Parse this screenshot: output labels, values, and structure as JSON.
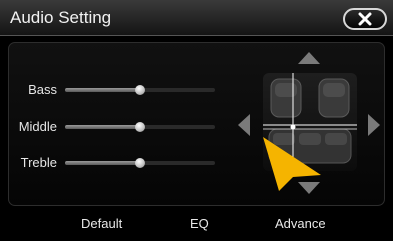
{
  "header": {
    "title": "Audio Setting",
    "close_icon": "close-x-icon"
  },
  "sliders": [
    {
      "label": "Bass",
      "level": 0.5
    },
    {
      "label": "Middle",
      "level": 0.5
    },
    {
      "label": "Treble",
      "level": 0.5
    }
  ],
  "balance": {
    "icons": [
      "arrow-up-icon",
      "arrow-down-icon",
      "arrow-left-icon",
      "arrow-right-icon",
      "car-seats-icon",
      "pointer-cursor-icon"
    ],
    "crosshair_color": "#ffffff"
  },
  "bottom": {
    "default_label": "Default",
    "eq_label": "EQ",
    "advance_label": "Advance"
  },
  "colors": {
    "cursor": "#f5b400",
    "arrow": "#7a7a7a"
  }
}
